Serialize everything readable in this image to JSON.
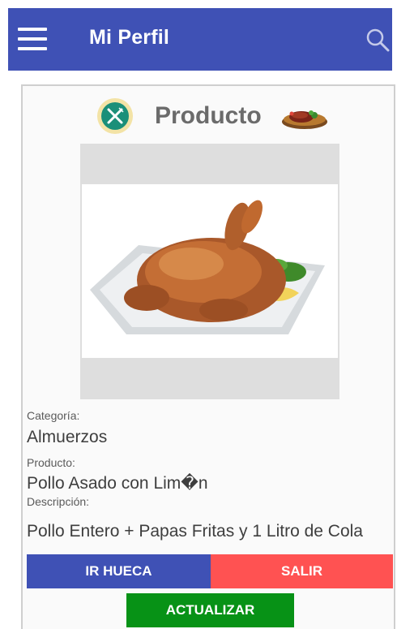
{
  "appbar": {
    "title": "Mi Perfil",
    "menu_icon": "hamburger-menu-icon",
    "search_icon": "search-icon",
    "color": "#3f51b5"
  },
  "header": {
    "title": "Producto",
    "logo_icon": "utensils-logo-icon",
    "dish_icon": "steak-dish-icon"
  },
  "product_image": "roast-chicken-image",
  "fields": {
    "category_label": "Categoría:",
    "category_value": "Almuerzos",
    "product_label": "Producto:",
    "product_value": "Pollo Asado con Lim�n",
    "description_label": "Descripción:",
    "description_value": "Pollo Entero + Papas Fritas y 1 Litro de Cola"
  },
  "buttons": {
    "go_label": "IR HUECA",
    "exit_label": "SALIR",
    "update_label": "ACTUALIZAR"
  },
  "colors": {
    "primary": "#3f51b5",
    "danger": "#ff5252",
    "success": "#079216"
  }
}
